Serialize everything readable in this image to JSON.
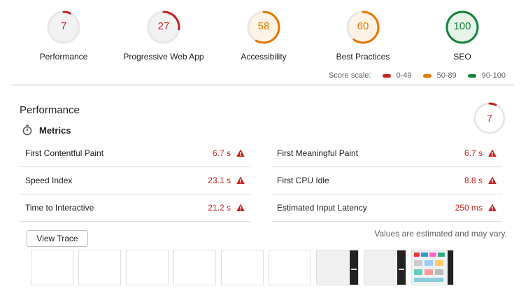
{
  "gauges": [
    {
      "score": "7",
      "label": "Performance",
      "fraction": 0.07,
      "color": "#c7221f"
    },
    {
      "score": "27",
      "label": "Progressive Web App",
      "fraction": 0.27,
      "color": "#c7221f"
    },
    {
      "score": "58",
      "label": "Accessibility",
      "fraction": 0.58,
      "color": "#e67700"
    },
    {
      "score": "60",
      "label": "Best Practices",
      "fraction": 0.6,
      "color": "#e67700"
    },
    {
      "score": "100",
      "label": "SEO",
      "fraction": 1.0,
      "color": "#178239"
    }
  ],
  "scale": {
    "title": "Score scale:",
    "low": "0-49",
    "mid": "50-89",
    "high": "90-100",
    "low_color": "#c7221f",
    "mid_color": "#e67700",
    "high_color": "#178239"
  },
  "section": {
    "title": "Performance",
    "score": "7",
    "score_fraction": 0.07,
    "metrics_title": "Metrics"
  },
  "metrics_left": [
    {
      "name": "First Contentful Paint",
      "value": "6.7 s"
    },
    {
      "name": "Speed Index",
      "value": "23.1 s"
    },
    {
      "name": "Time to Interactive",
      "value": "21.2 s"
    }
  ],
  "metrics_right": [
    {
      "name": "First Meaningful Paint",
      "value": "6.7 s"
    },
    {
      "name": "First CPU Idle",
      "value": "8.8 s"
    },
    {
      "name": "Estimated Input Latency",
      "value": "250 ms"
    }
  ],
  "view_trace": "View Trace",
  "estimate_note": "Values are estimated and may vary."
}
